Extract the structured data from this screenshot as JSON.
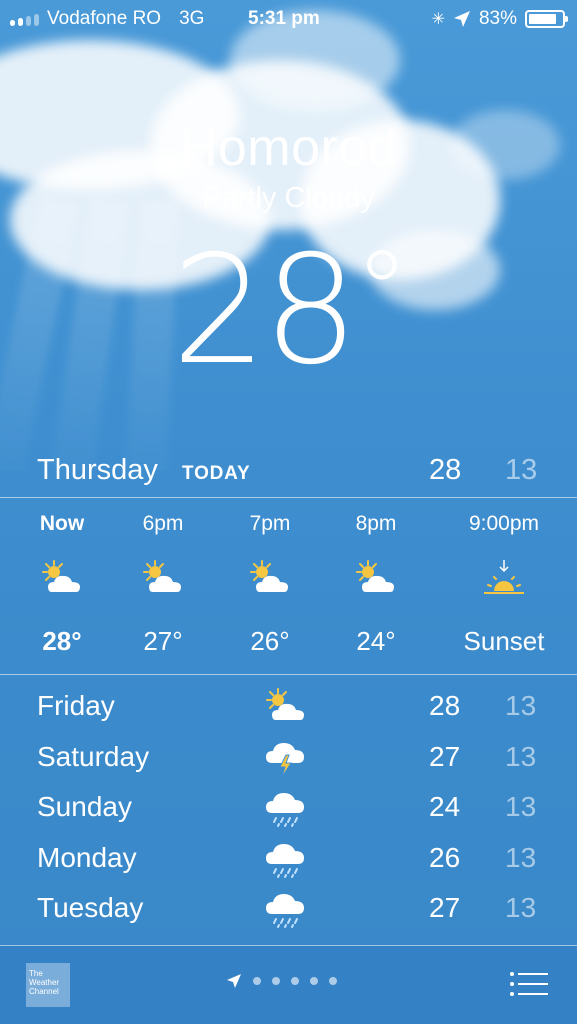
{
  "status_bar": {
    "carrier": "Vodafone RO",
    "network": "3G",
    "time": "5:31 pm",
    "battery": "83%",
    "battery_level": 0.83
  },
  "location": {
    "city": "Homorod",
    "condition": "Partly Cloudy",
    "temperature": "28"
  },
  "today": {
    "day": "Thursday",
    "tag": "TODAY",
    "high": "28",
    "low": "13"
  },
  "hourly": [
    {
      "label": "Now",
      "icon": "partly-cloudy-sun-icon",
      "value": "28°"
    },
    {
      "label": "6pm",
      "icon": "partly-cloudy-sun-icon",
      "value": "27°"
    },
    {
      "label": "7pm",
      "icon": "partly-cloudy-sun-icon",
      "value": "26°"
    },
    {
      "label": "8pm",
      "icon": "partly-cloudy-sun-icon",
      "value": "24°"
    },
    {
      "label": "9:00pm",
      "icon": "sunset-icon",
      "value": "Sunset"
    }
  ],
  "daily": [
    {
      "day": "Friday",
      "icon": "partly-cloudy-sun-icon",
      "high": "28",
      "low": "13"
    },
    {
      "day": "Saturday",
      "icon": "thunderstorm-icon",
      "high": "27",
      "low": "13"
    },
    {
      "day": "Sunday",
      "icon": "rain-icon",
      "high": "24",
      "low": "13"
    },
    {
      "day": "Monday",
      "icon": "rain-icon",
      "high": "26",
      "low": "13"
    },
    {
      "day": "Tuesday",
      "icon": "rain-icon",
      "high": "27",
      "low": "13"
    }
  ],
  "bottom_bar": {
    "logo_text": "The Weather Channel",
    "page_dots": 5
  },
  "colors": {
    "sky_blue": "#3f8fd0",
    "sun_yellow": "#f5c642"
  }
}
